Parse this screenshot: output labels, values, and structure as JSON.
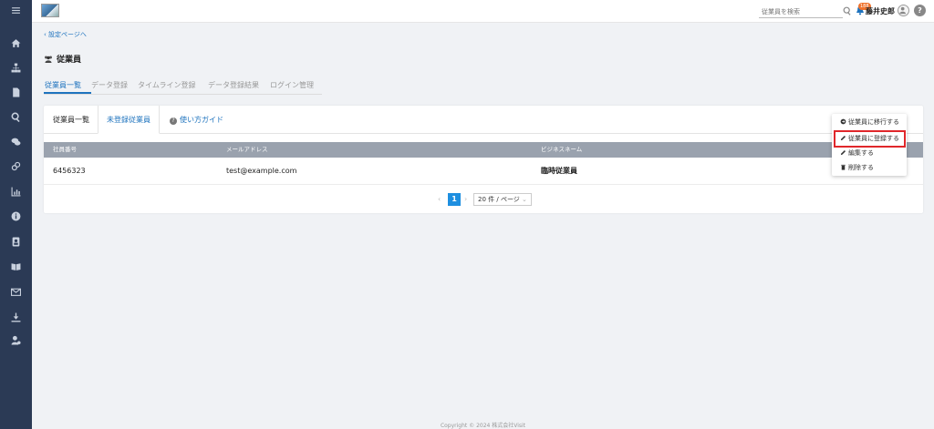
{
  "sidebar": {
    "items": [
      {
        "name": "menu-icon"
      },
      {
        "name": "home-icon"
      },
      {
        "name": "org-chart-icon"
      },
      {
        "name": "document-icon"
      },
      {
        "name": "search-icon"
      },
      {
        "name": "chat-icon"
      },
      {
        "name": "link-icon"
      },
      {
        "name": "chart-icon"
      },
      {
        "name": "info-icon"
      },
      {
        "name": "contacts-icon"
      },
      {
        "name": "book-icon"
      },
      {
        "name": "mail-icon"
      },
      {
        "name": "download-icon"
      },
      {
        "name": "user-settings-icon"
      }
    ]
  },
  "header": {
    "search_placeholder": "従業員を検索",
    "notification_count": "188",
    "user_name": "藤井史郎",
    "help_label": "?"
  },
  "breadcrumb": {
    "back_label": "設定ページへ"
  },
  "page": {
    "title": "従業員"
  },
  "tabs": [
    {
      "label": "従業員一覧"
    },
    {
      "label": "データ登録"
    },
    {
      "label": "タイムライン登録"
    },
    {
      "label": "データ登録結果"
    },
    {
      "label": "ログイン管理"
    }
  ],
  "subtabs": [
    {
      "label": "従業員一覧"
    },
    {
      "label": "未登録従業員"
    },
    {
      "label": "使い方ガイド"
    }
  ],
  "table": {
    "headers": [
      "社員番号",
      "メールアドレス",
      "ビジネスネーム"
    ],
    "rows": [
      {
        "employee_id": "6456323",
        "email": "test@example.com",
        "business_name": "臨時従業員"
      }
    ]
  },
  "pagination": {
    "current_page": "1",
    "page_size": "20 件 / ページ"
  },
  "dropdown": {
    "items": [
      {
        "label": "従業員に移行する",
        "icon": "move-icon"
      },
      {
        "label": "従業員に登録する",
        "icon": "pencil-icon"
      },
      {
        "label": "編集する",
        "icon": "pencil-icon"
      },
      {
        "label": "削除する",
        "icon": "trash-icon"
      }
    ]
  },
  "footer": {
    "text": "Copyright © 2024 株式会社Visit"
  },
  "colors": {
    "accent": "#1e73be",
    "sidebar": "#2b3a55",
    "highlight": "#e0272b",
    "badge": "#f0732d"
  }
}
